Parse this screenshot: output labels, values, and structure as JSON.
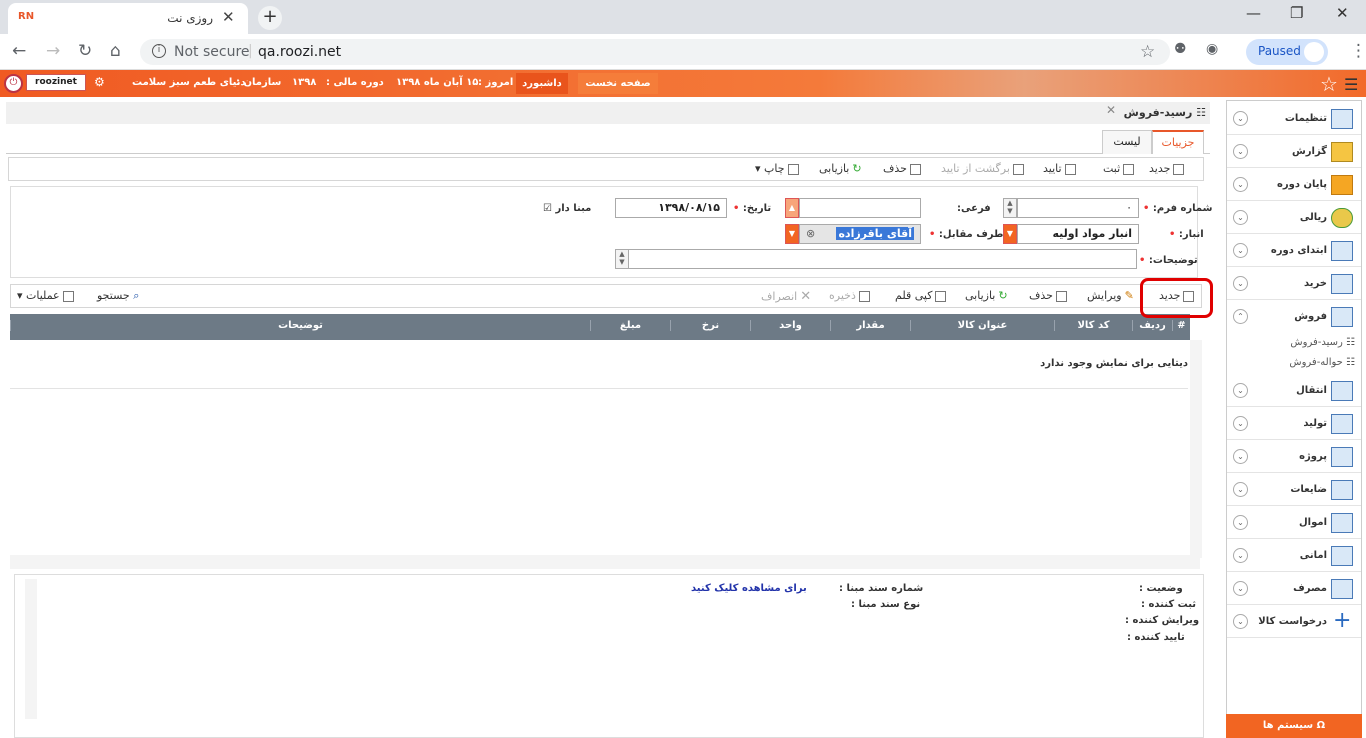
{
  "browser": {
    "tab_title": "روزی نت",
    "favicon": "RN",
    "url": "qa.roozi.net",
    "security": "Not secure",
    "profile": "Paused"
  },
  "header": {
    "user": "roozinet",
    "org_label": "سازمان :",
    "org": "دنیای طعم سبز سلامت",
    "period_label": "دوره مالی :",
    "period": "۱۳۹۸",
    "today_label": "امروز :",
    "today": "۱۵ آبان ماه ۱۳۹۸",
    "dashboard": "داشبورد",
    "home": "صفحه نخست"
  },
  "page": {
    "title": "رسید-فروش",
    "tabs": [
      "جزییات",
      "لیست"
    ]
  },
  "toolbar": {
    "new": "جدید",
    "register": "ثبت",
    "confirm": "تایید",
    "unconfirm": "برگشت از تایید",
    "delete": "حذف",
    "reload": "بازیابی",
    "print": "چاپ"
  },
  "form": {
    "form_no_label": "شماره فرم:",
    "form_no": "۰",
    "sub_label": "فرعی:",
    "sub": "",
    "date_label": "تاریخ:",
    "date": "۱۳۹۸/۰۸/۱۵",
    "has_base_label": "مبنا دار",
    "warehouse_label": "انبار:",
    "warehouse": "انبار مواد اولیه",
    "party_label": "طرف مقابل:",
    "party": "آقای باقرزاده",
    "desc_label": "توضیحات:",
    "desc": ""
  },
  "gridtoolbar": {
    "new": "جدید",
    "edit": "ویرایش",
    "delete": "حذف",
    "reload": "بازیابی",
    "copy": "کپی قلم",
    "save": "ذخیره",
    "cancel": "انصراف",
    "search": "جستجو",
    "ops": "عملیات"
  },
  "grid": {
    "columns": [
      "#",
      "ردیف",
      "کد کالا",
      "عنوان کالا",
      "مقدار",
      "واحد",
      "نرخ",
      "مبلغ",
      "توضیحات"
    ],
    "empty": "دیتایی برای نمایش وجود ندارد"
  },
  "info": {
    "status": "وضعیت :",
    "creator": "ثبت کننده :",
    "editor": "ویرایش کننده :",
    "approver": "تایید کننده :",
    "base_no": "شماره سند مبنا :",
    "base_type": "نوع سند مبنا :",
    "link": "برای مشاهده کلیک کنید"
  },
  "sidebar": {
    "items": [
      {
        "label": "تنظیمات",
        "icon": "settings-folder-icon"
      },
      {
        "label": "گزارش",
        "icon": "clipboard-icon"
      },
      {
        "label": "پایان دوره",
        "icon": "folders-icon"
      },
      {
        "label": "ریالی",
        "icon": "coins-icon"
      },
      {
        "label": "ابتدای دوره",
        "icon": "table-star-icon"
      },
      {
        "label": "خرید",
        "icon": "table-star-icon"
      },
      {
        "label": "فروش",
        "icon": "table-star-icon"
      },
      {
        "label": "انتقال",
        "icon": "table-star-icon"
      },
      {
        "label": "تولید",
        "icon": "table-star-icon"
      },
      {
        "label": "پروژه",
        "icon": "table-star-icon"
      },
      {
        "label": "ضایعات",
        "icon": "table-star-icon"
      },
      {
        "label": "اموال",
        "icon": "table-star-icon"
      },
      {
        "label": "امانی",
        "icon": "table-star-icon"
      },
      {
        "label": "مصرف",
        "icon": "table-star-icon"
      },
      {
        "label": "درخواست کالا",
        "icon": "plus-icon"
      }
    ],
    "sub": [
      "رسید-فروش",
      "حواله-فروش"
    ],
    "systems": "سیستم ها"
  }
}
